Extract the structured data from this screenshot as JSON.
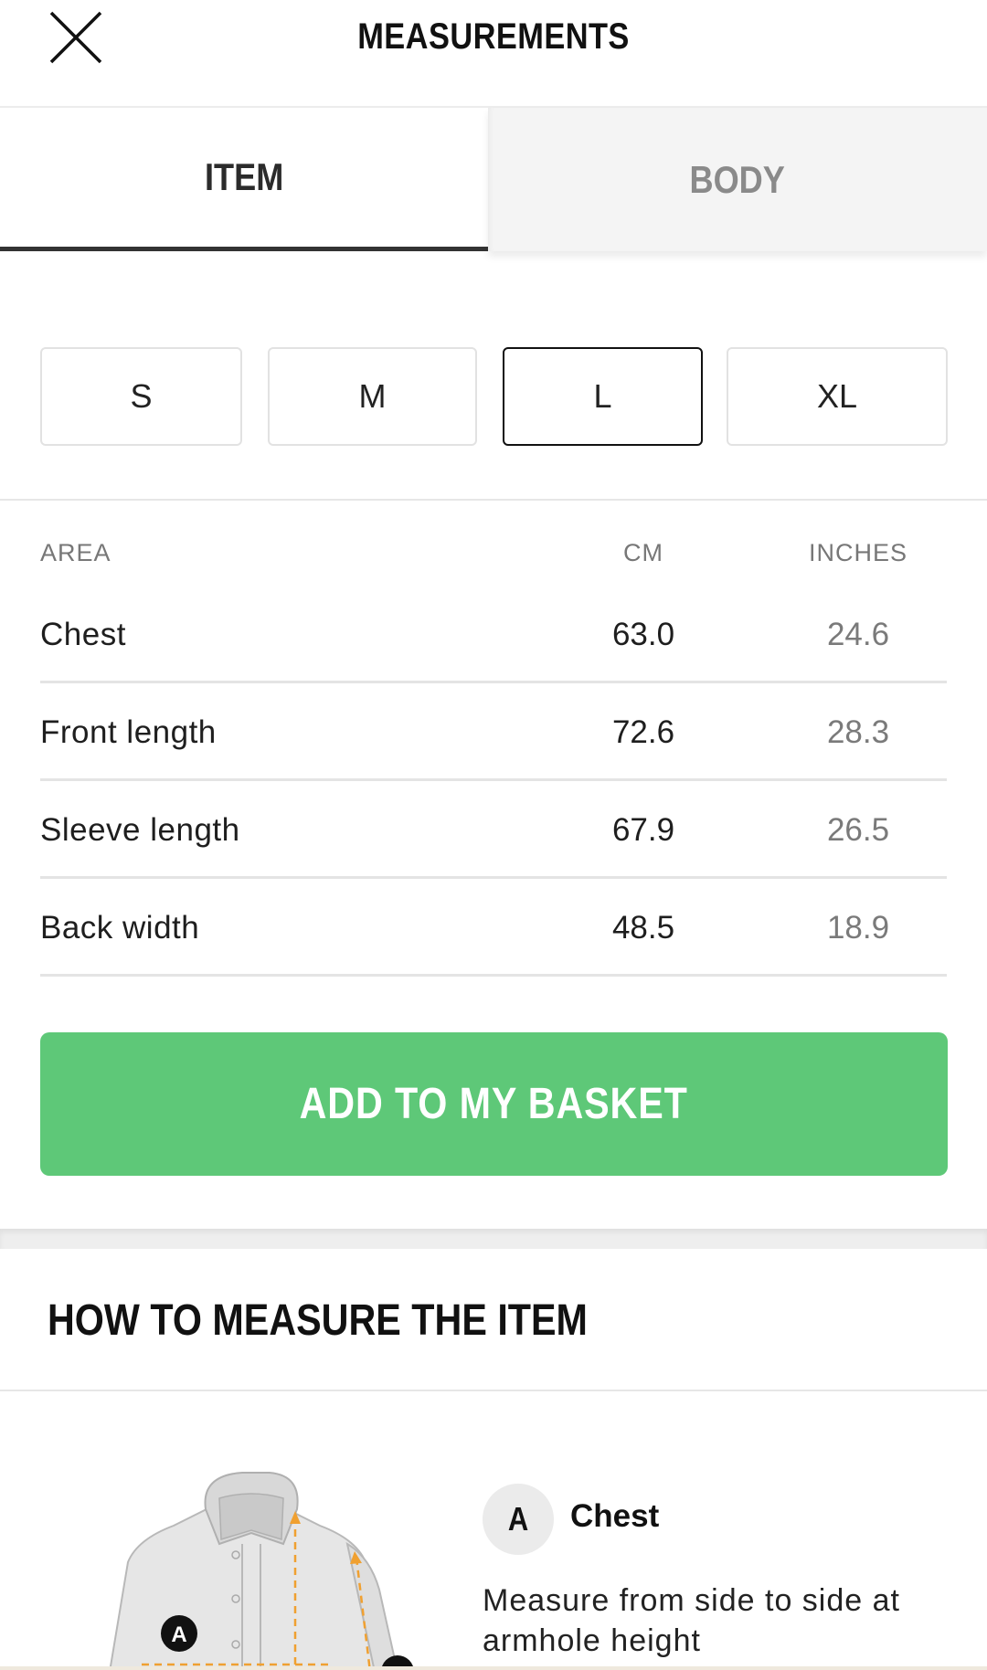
{
  "header": {
    "title": "MEASUREMENTS",
    "close_icon": "close-icon"
  },
  "tabs": [
    {
      "label": "ITEM",
      "active": true
    },
    {
      "label": "BODY",
      "active": false
    }
  ],
  "sizes": {
    "options": [
      "S",
      "M",
      "L",
      "XL"
    ],
    "selected": "L"
  },
  "table": {
    "headers": {
      "area": "AREA",
      "cm": "CM",
      "inches": "INCHES"
    },
    "rows": [
      {
        "area": "Chest",
        "cm": "63.0",
        "inches": "24.6"
      },
      {
        "area": "Front length",
        "cm": "72.6",
        "inches": "28.3"
      },
      {
        "area": "Sleeve length",
        "cm": "67.9",
        "inches": "26.5"
      },
      {
        "area": "Back width",
        "cm": "48.5",
        "inches": "18.9"
      }
    ]
  },
  "basket": {
    "label": "ADD TO MY BASKET",
    "color": "#5ec878"
  },
  "howto": {
    "title": "HOW TO MEASURE THE ITEM",
    "diagram_markers": [
      "A"
    ],
    "measure": {
      "letter": "A",
      "name": "Chest",
      "description": "Measure from side to side at armhole height"
    }
  },
  "colors": {
    "accent": "#5ec878",
    "measure_arrow": "#f0a030"
  }
}
